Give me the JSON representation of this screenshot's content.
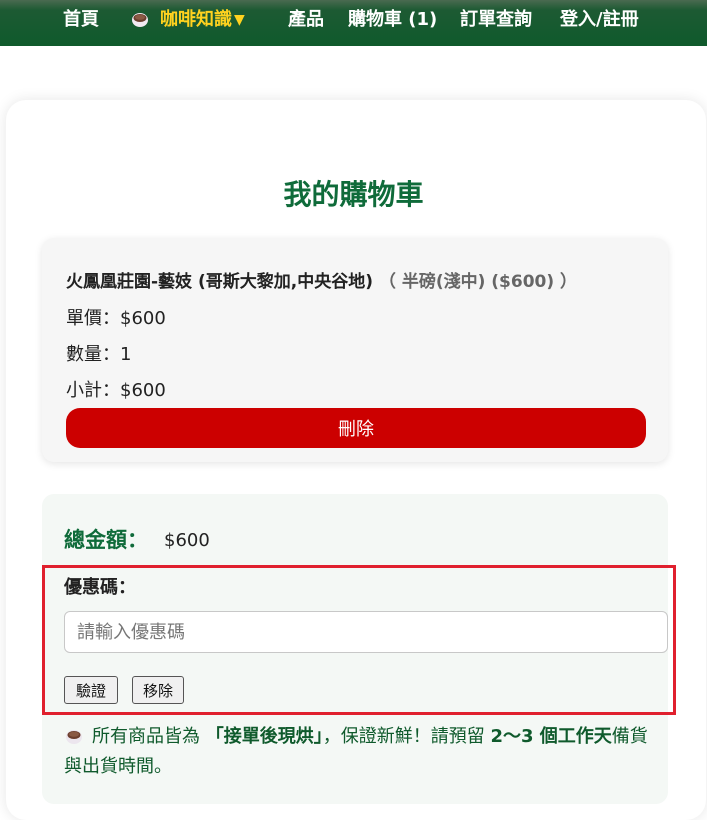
{
  "nav": {
    "home": "首頁",
    "knowledge": "咖啡知識",
    "knowledge_caret": "▼",
    "products": "產品",
    "cart": "購物車 (1)",
    "orders": "訂單查詢",
    "login": "登入/註冊"
  },
  "page_title": "我的購物車",
  "cart_item": {
    "name": "火鳳凰莊園-藝妓 (哥斯大黎加,中央谷地)",
    "variant": "（ 半磅(淺中) ($600) ）",
    "unit_price": "單價：$600",
    "quantity": "數量：1",
    "subtotal": "小計：$600",
    "delete_label": "刪除"
  },
  "summary": {
    "total_label": "總金額：",
    "total_value": "$600",
    "coupon_label": "優惠碼：",
    "coupon_placeholder": "請輸入優惠碼",
    "verify_label": "驗證",
    "remove_label": "移除",
    "notice_prefix": "所有商品皆為",
    "notice_highlight": "「接單後現烘」",
    "notice_middle": "，保證新鮮！請預留",
    "notice_days": "2〜3 個工作天",
    "notice_suffix": "備貨與出貨時間。"
  },
  "colors": {
    "nav_bg": "#0f5a2c",
    "nav_active": "#ffd21f",
    "title_green": "#0f6b3a",
    "delete_red": "#cc0000",
    "highlight_border": "#e0202e"
  },
  "icons": {
    "nav_cup": "coffee-cup-icon",
    "notice_cup": "coffee-cup-icon"
  }
}
